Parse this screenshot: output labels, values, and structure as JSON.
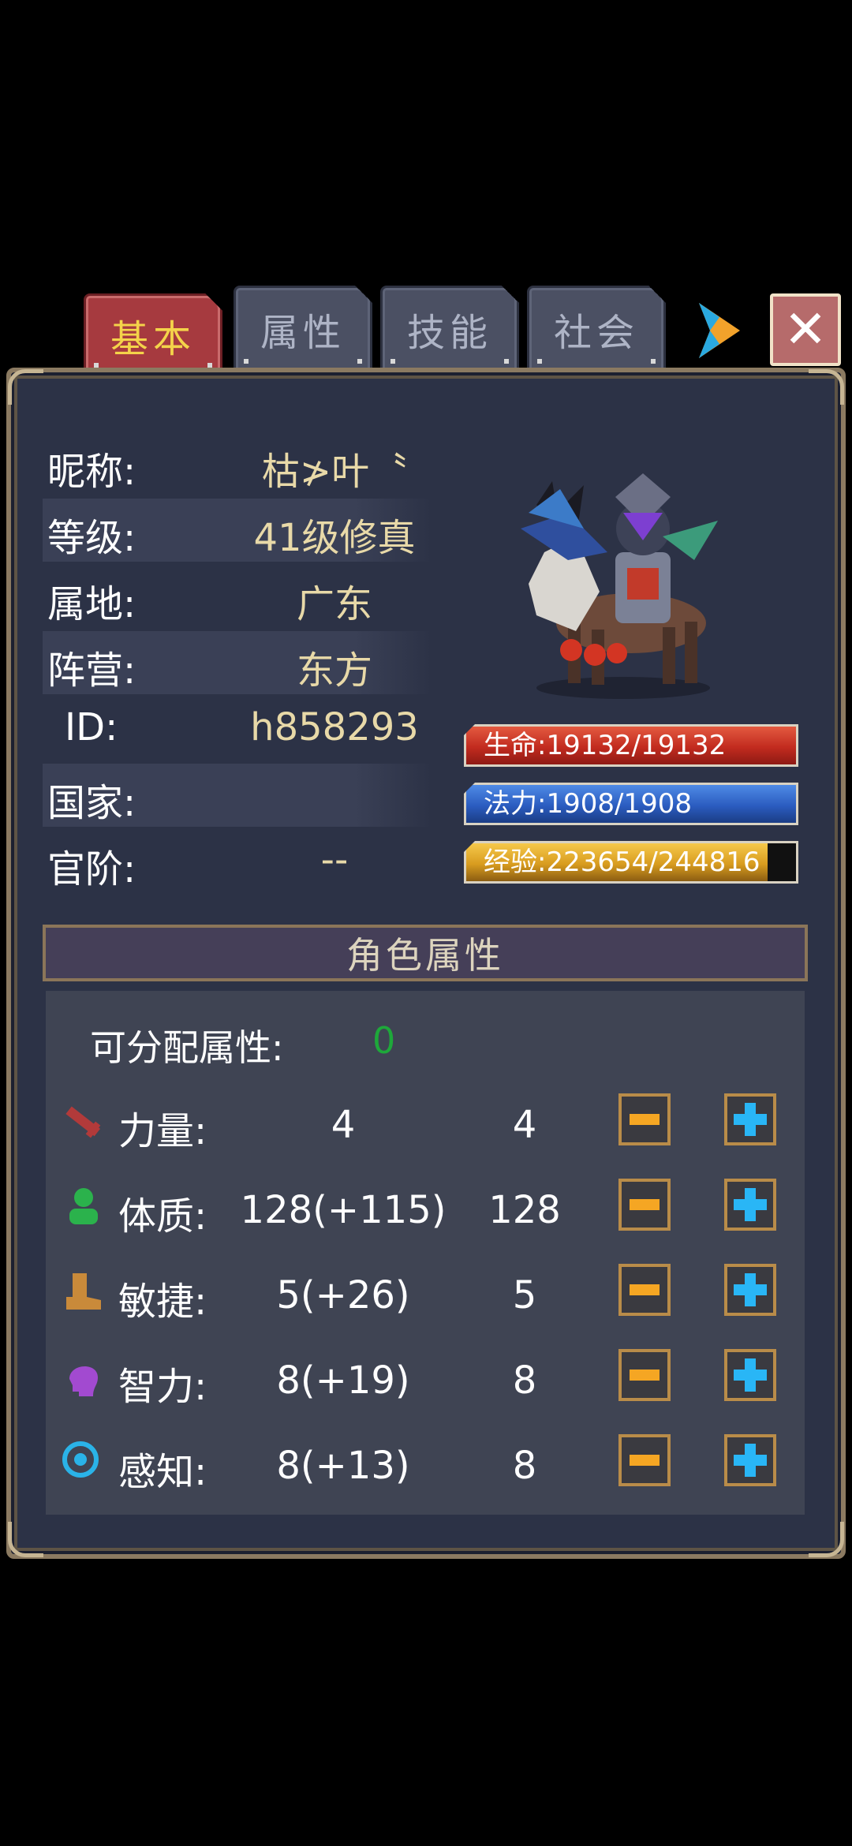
{
  "tabs": [
    {
      "label": "基本",
      "active": true
    },
    {
      "label": "属性",
      "active": false
    },
    {
      "label": "技能",
      "active": false
    },
    {
      "label": "社会",
      "active": false
    }
  ],
  "close_label": "✕",
  "info": {
    "nickname_label": "昵称:",
    "nickname_value": "枯≯叶〝",
    "level_label": "等级:",
    "level_value": "41级修真",
    "region_label": "属地:",
    "region_value": "广东",
    "faction_label": "阵营:",
    "faction_value": "东方",
    "id_label": "ID:",
    "id_value": "h858293",
    "country_label": "国家:",
    "country_value": "",
    "rank_label": "官阶:",
    "rank_value": "--"
  },
  "bars": {
    "life_text": "生命:19132/19132",
    "mana_text": "法力:1908/1908",
    "exp_text": "经验:223654/244816",
    "exp_fraction": 0.914
  },
  "attributes": {
    "title": "角色属性",
    "free_label": "可分配属性:",
    "free_value": "0",
    "stats": [
      {
        "icon": "sword-icon",
        "label": "力量:",
        "total": "4",
        "base": "4"
      },
      {
        "icon": "person-icon",
        "label": "体质:",
        "total": "128(+115)",
        "base": "128"
      },
      {
        "icon": "boot-icon",
        "label": "敏捷:",
        "total": "5(+26)",
        "base": "5"
      },
      {
        "icon": "head-icon",
        "label": "智力:",
        "total": "8(+19)",
        "base": "8"
      },
      {
        "icon": "target-icon",
        "label": "感知:",
        "total": "8(+13)",
        "base": "8"
      }
    ]
  },
  "colors": {
    "accent_gold": "#f4d34a",
    "panel_bg": "#2c3246",
    "free_points_green": "#1ea83a"
  }
}
